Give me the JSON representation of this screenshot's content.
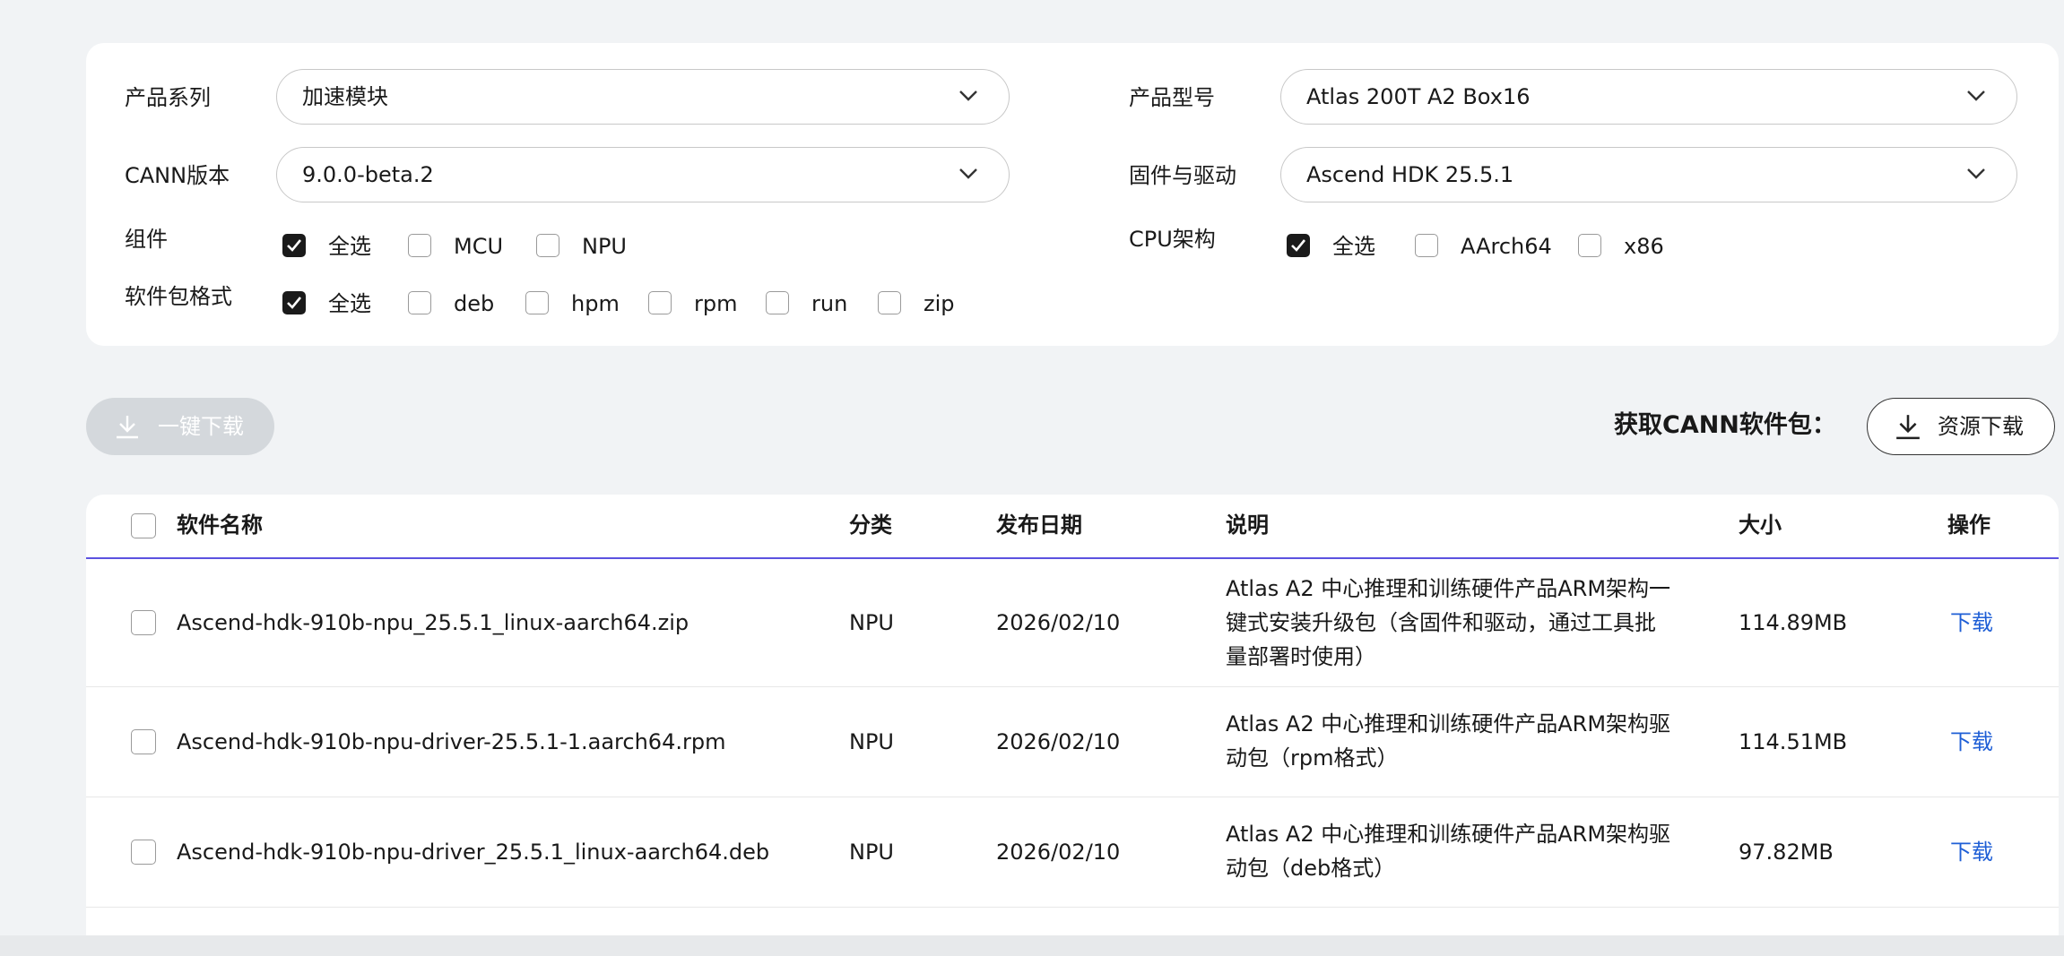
{
  "filters": {
    "product_series": {
      "label": "产品系列",
      "value": "加速模块"
    },
    "product_model": {
      "label": "产品型号",
      "value": "Atlas 200T A2 Box16"
    },
    "cann_version": {
      "label": "CANN版本",
      "value": "9.0.0-beta.2"
    },
    "firmware_driver": {
      "label": "固件与驱动",
      "value": "Ascend HDK 25.5.1"
    },
    "components": {
      "label": "组件",
      "options": [
        {
          "label": "全选",
          "checked": true
        },
        {
          "label": "MCU",
          "checked": false
        },
        {
          "label": "NPU",
          "checked": false
        }
      ]
    },
    "cpu_arch": {
      "label": "CPU架构",
      "options": [
        {
          "label": "全选",
          "checked": true
        },
        {
          "label": "AArch64",
          "checked": false
        },
        {
          "label": "x86",
          "checked": false
        }
      ]
    },
    "package_format": {
      "label": "软件包格式",
      "options": [
        {
          "label": "全选",
          "checked": true
        },
        {
          "label": "deb",
          "checked": false
        },
        {
          "label": "hpm",
          "checked": false
        },
        {
          "label": "rpm",
          "checked": false
        },
        {
          "label": "run",
          "checked": false
        },
        {
          "label": "zip",
          "checked": false
        }
      ]
    }
  },
  "actions": {
    "download_all": "一键下载",
    "cann_title": "获取CANN软件包：",
    "resource_download": "资源下载"
  },
  "table": {
    "columns": {
      "name": "软件名称",
      "category": "分类",
      "date": "发布日期",
      "desc": "说明",
      "size": "大小",
      "op": "操作"
    },
    "rows": [
      {
        "name": "Ascend-hdk-910b-npu_25.5.1_linux-aarch64.zip",
        "category": "NPU",
        "date": "2026/02/10",
        "desc_lines": [
          "Atlas A2 中心推理和训练硬件产品ARM架构一",
          "键式安装升级包（含固件和驱动，通过工具批",
          "量部署时使用）"
        ],
        "size": "114.89MB",
        "op": "下载"
      },
      {
        "name": "Ascend-hdk-910b-npu-driver-25.5.1-1.aarch64.rpm",
        "category": "NPU",
        "date": "2026/02/10",
        "desc_lines": [
          "Atlas A2 中心推理和训练硬件产品ARM架构驱",
          "动包（rpm格式）"
        ],
        "size": "114.51MB",
        "op": "下载"
      },
      {
        "name": "Ascend-hdk-910b-npu-driver_25.5.1_linux-aarch64.deb",
        "category": "NPU",
        "date": "2026/02/10",
        "desc_lines": [
          "Atlas A2 中心推理和训练硬件产品ARM架构驱",
          "动包（deb格式）"
        ],
        "size": "97.82MB",
        "op": "下载"
      }
    ]
  },
  "colors": {
    "accent_link": "#1f5fd6",
    "header_underline": "#5b52e0",
    "checked_box": "#1a1a1a",
    "disabled_button": "#d4d8dc"
  }
}
